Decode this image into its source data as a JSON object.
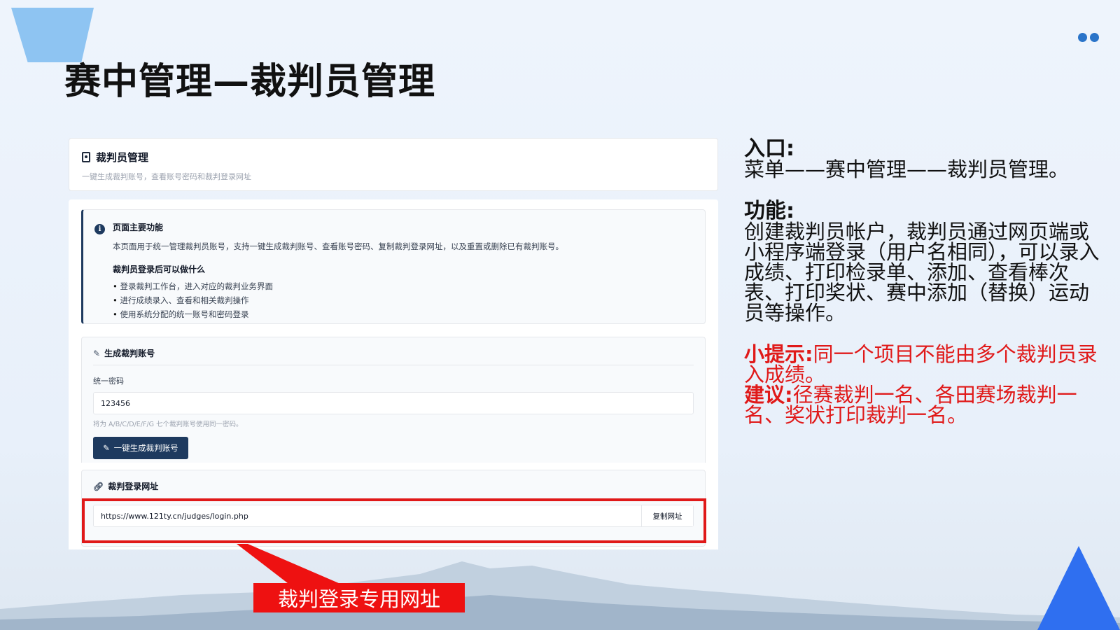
{
  "slide": {
    "title": "赛中管理—裁判员管理"
  },
  "card": {
    "title": "裁判员管理",
    "subtitle": "一键生成裁判账号，查看账号密码和裁判登录网址"
  },
  "info": {
    "heading": "页面主要功能",
    "description": "本页面用于统一管理裁判员账号，支持一键生成裁判账号、查看账号密码、复制裁判登录网址，以及重置或删除已有裁判账号。",
    "subheading": "裁判员登录后可以做什么",
    "items": [
      "登录裁判工作台，进入对应的裁判业务界面",
      "进行成绩录入、查看和相关裁判操作",
      "使用系统分配的统一账号和密码登录"
    ]
  },
  "generate": {
    "title": "生成裁判账号",
    "password_label": "统一密码",
    "password_value": "123456",
    "hint": "将为 A/B/C/D/E/F/G 七个裁判账号使用同一密码。",
    "button_label": "一键生成裁判账号"
  },
  "login_url": {
    "title": "裁判登录网址",
    "url": "https://www.121ty.cn/judges/login.php",
    "copy_label": "复制网址"
  },
  "callout": {
    "label": "裁判登录专用网址"
  },
  "right_panel": {
    "entry_heading": "入口:",
    "entry_text": "菜单——赛中管理——裁判员管理。",
    "function_heading": "功能:",
    "function_text": "创建裁判员帐户，裁判员通过网页端或小程序端登录（用户名相同），可以录入成绩、打印检录单、添加、查看棒次表、打印奖状、赛中添加（替换）运动员等操作。",
    "tip_heading": "小提示:",
    "tip_text": "同一个项目不能由多个裁判员录入成绩。",
    "advice_heading": "建议:",
    "advice_text": "径赛裁判一名、各田赛场裁判一名、奖状打印裁判一名。"
  },
  "colors": {
    "accent_red": "#e01919",
    "primary_navy": "#1e3a5f",
    "deco_blue": "#2f6ff0"
  }
}
